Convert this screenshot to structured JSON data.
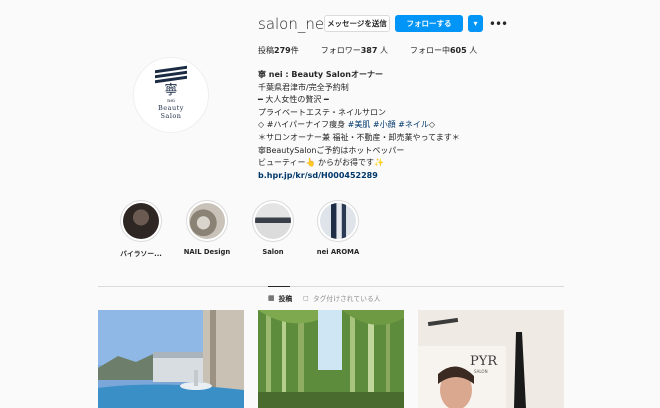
{
  "profile": {
    "username": "salon_nei",
    "message_button": "メッセージを送信",
    "follow_button": "フォローする",
    "dropdown_glyph": "▾",
    "more_glyph": "•••",
    "avatar": {
      "kanji": "寧",
      "small_text": "nei",
      "brand_line1": "Beauty",
      "brand_line2": "Salon"
    }
  },
  "stats": {
    "posts_label": "投稿",
    "posts_count": "279",
    "posts_suffix": "件",
    "followers_label": "フォロワー",
    "followers_count": "387",
    "followers_suffix": "人",
    "following_label": "フォロー中",
    "following_count": "605",
    "following_suffix": "人"
  },
  "bio": {
    "name": "寧 nei : Beauty Salonオーナー",
    "line1": "千葉県君津市/完全予約制",
    "line2": "━ 大人女性の贅沢 ━",
    "line3": "プライベートエステ・ネイルサロン",
    "line4_prefix": "◇ #ハイパーナイフ痩身 ",
    "line4_tag1": "#美肌",
    "line4_tag2": " #小顔",
    "line4_tag3": " #ネイル",
    "line4_suffix": "◇",
    "line5": "＊サロンオーナー兼 福祉・不動産・卸売業やってます＊",
    "line6": "寧BeautySalonご予約はホットペッパー",
    "line7": "ビューティー👆 からがお得です✨",
    "link": "b.hpr.jp/kr/sd/H000452289"
  },
  "highlights": [
    {
      "label": "バイラソー..."
    },
    {
      "label": "NAIL Design"
    },
    {
      "label": "Salon"
    },
    {
      "label": "nei AROMA"
    }
  ],
  "tabs": {
    "posts_icon": "grid-icon",
    "posts_glyph": "▦",
    "posts_label": "投稿",
    "tagged_icon": "tag-icon",
    "tagged_glyph": "◻",
    "tagged_label": "タグ付けされている人"
  },
  "posts": [
    {
      "alt": "resort pool with palm and mountains"
    },
    {
      "alt": "bamboo forest"
    },
    {
      "alt": "PYR salon poster",
      "overlay_text": "PYR",
      "overlay_sub": "SALON"
    }
  ],
  "colors": {
    "accent": "#0095f6",
    "link": "#00376b",
    "background": "#fafafa",
    "border": "#dbdbdb"
  }
}
